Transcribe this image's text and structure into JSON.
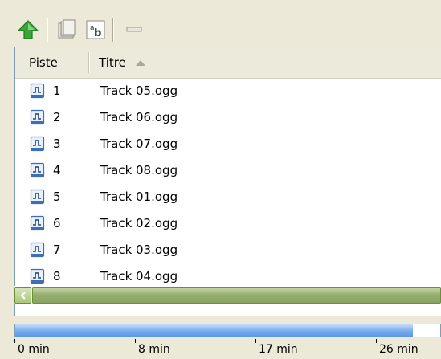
{
  "toolbar": {
    "buttons": [
      {
        "name": "up-arrow-icon"
      },
      {
        "name": "folder-icon"
      },
      {
        "name": "rename-icon",
        "glyph": "ab"
      },
      {
        "name": "minus-icon"
      }
    ]
  },
  "list": {
    "columns": [
      "Piste",
      "Titre"
    ],
    "sort_column": "Titre",
    "sort_direction": "ascending",
    "rows": [
      {
        "num": "1",
        "title": "Track 05.ogg"
      },
      {
        "num": "2",
        "title": "Track 06.ogg"
      },
      {
        "num": "3",
        "title": "Track 07.ogg"
      },
      {
        "num": "4",
        "title": "Track 08.ogg"
      },
      {
        "num": "5",
        "title": "Track 01.ogg"
      },
      {
        "num": "6",
        "title": "Track 02.ogg"
      },
      {
        "num": "7",
        "title": "Track 03.ogg"
      },
      {
        "num": "8",
        "title": "Track 04.ogg"
      }
    ]
  },
  "timeline": {
    "fill_fraction": 0.935,
    "labels": [
      "0 min",
      "8 min",
      "17 min",
      "26 min"
    ]
  },
  "colors": {
    "accent_green": "#3aa53a",
    "progress_blue": "#5b97e6",
    "scroll_green": "#93ad6b"
  }
}
